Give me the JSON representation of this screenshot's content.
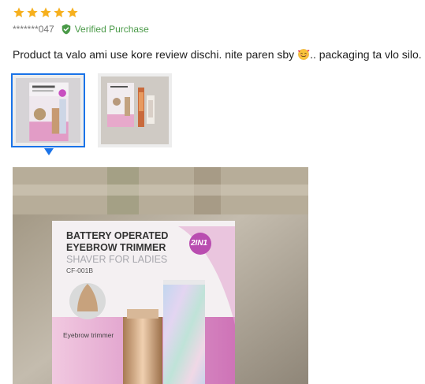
{
  "review": {
    "rating": 5,
    "username": "*******047",
    "verified_label": "Verified Purchase",
    "content_before": "Product ta valo ami use kore review dischi. nite paren sby ",
    "content_after": ".. packaging ta vlo silo."
  },
  "thumbnails": [
    {
      "name": "thumbnail-1",
      "active": true
    },
    {
      "name": "thumbnail-2",
      "active": false
    }
  ],
  "product_box": {
    "line1": "BATTERY OPERATED",
    "line2": "EYEBROW TRIMMER",
    "line3": "SHAVER FOR LADIES",
    "model": "CF-001B",
    "badge": "2IN1",
    "caption": "Eyebrow trimmer"
  },
  "colors": {
    "star": "#f6b01e",
    "verified": "#4a9a48",
    "active_thumb": "#1a73e8"
  },
  "icons": {
    "verified": "verified-shield-icon",
    "emoji": "smiling-face-with-hearts-icon"
  }
}
